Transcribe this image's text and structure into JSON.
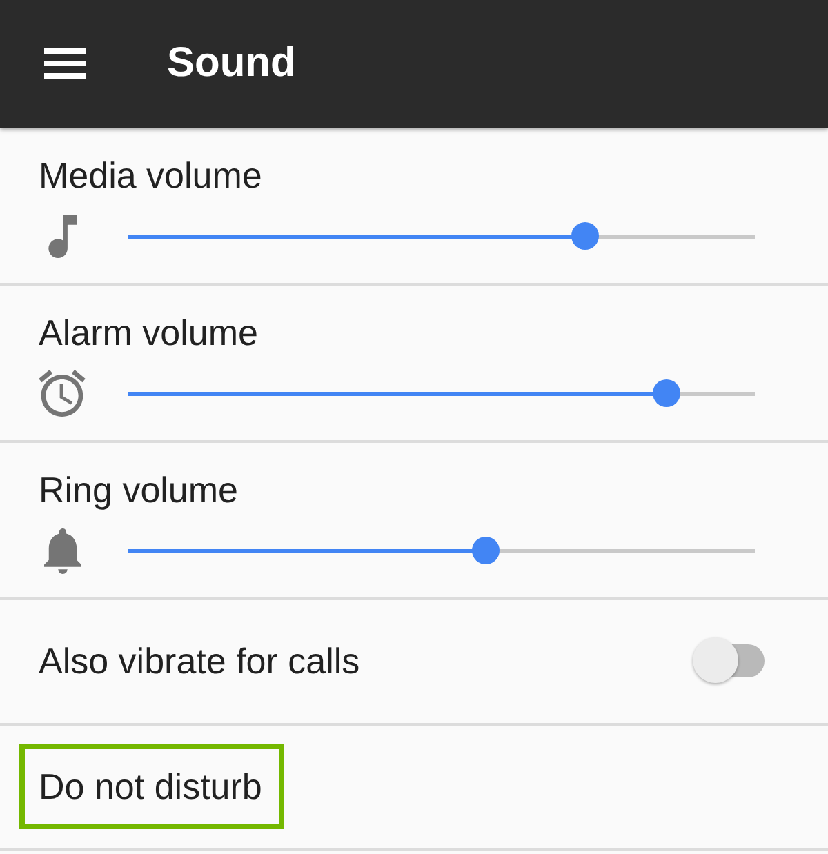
{
  "app_bar": {
    "title": "Sound"
  },
  "rows": [
    {
      "kind": "slider",
      "label": "Media volume",
      "level": 0.73
    },
    {
      "kind": "slider",
      "label": "Alarm volume",
      "level": 0.86
    },
    {
      "kind": "slider",
      "label": "Ring volume",
      "level": 0.57
    },
    {
      "kind": "switch",
      "label": "Also vibrate for calls",
      "on": false
    },
    {
      "kind": "plain",
      "label": "Do not disturb",
      "highlighted": true
    }
  ]
}
